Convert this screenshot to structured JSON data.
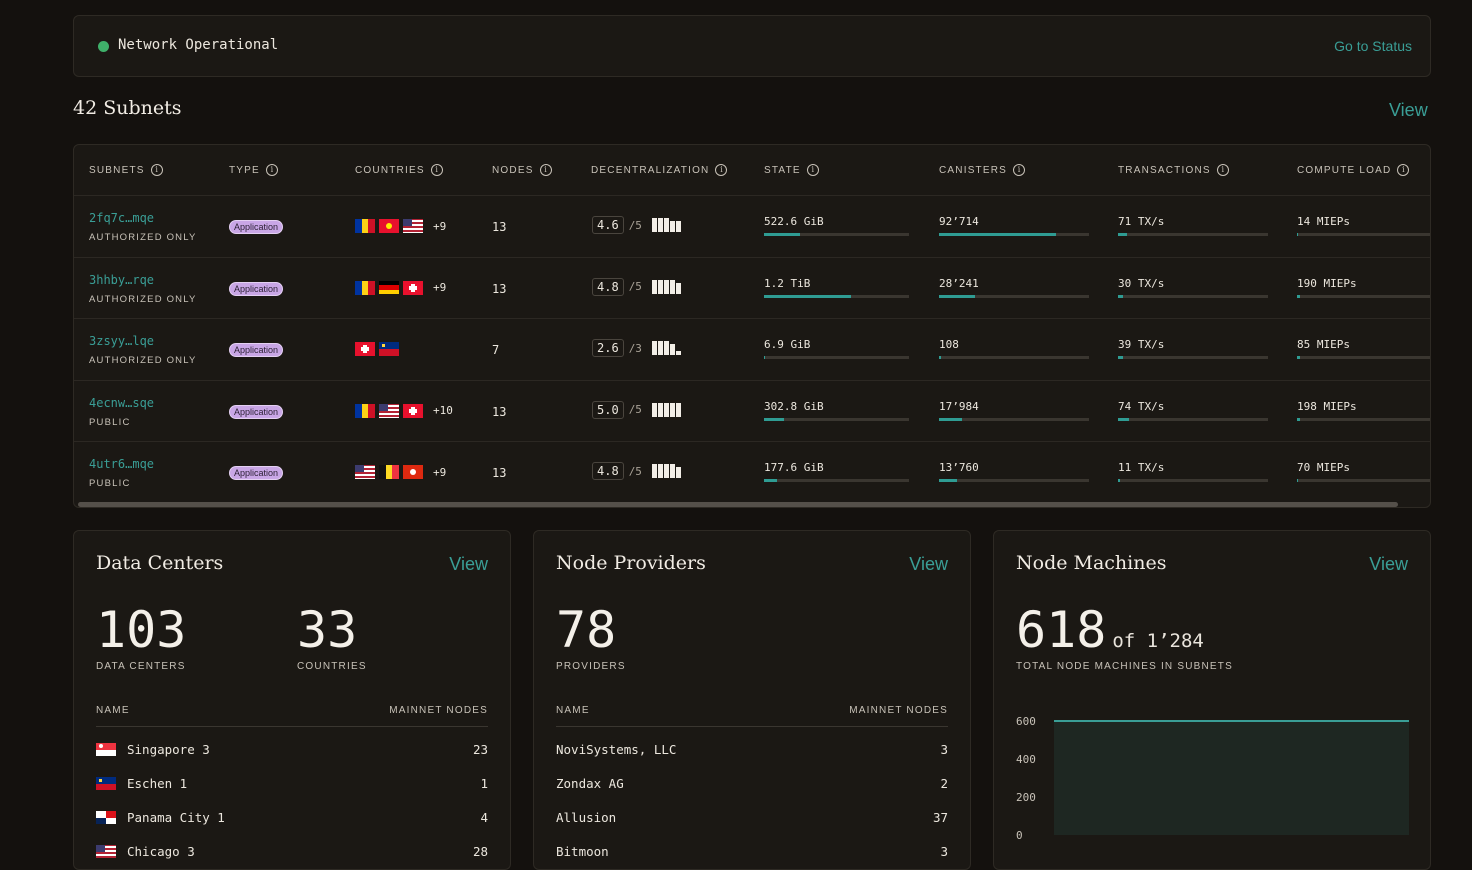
{
  "status": {
    "text": "Network Operational",
    "link": "Go to Status",
    "color": "#3fb06a"
  },
  "subnets_section": {
    "title": "42 Subnets",
    "view": "View"
  },
  "table": {
    "headers": [
      "SUBNETS",
      "TYPE",
      "COUNTRIES",
      "NODES",
      "DECENTRALIZATION",
      "STATE",
      "CANISTERS",
      "TRANSACTIONS",
      "COMPUTE LOAD"
    ],
    "rows": [
      {
        "id": "2fq7c…mqe",
        "access": "AUTHORIZED ONLY",
        "type": "Application",
        "flags": [
          "RO",
          "KG",
          "US"
        ],
        "more": "+9",
        "nodes": "13",
        "score": "4.6",
        "out_of": "/5",
        "bar_levels": [
          1,
          1,
          1,
          0.75,
          0.75
        ],
        "state": "522.6 GiB",
        "state_pct": 25,
        "canisters": "92’714",
        "canisters_pct": 78,
        "tx": "71 TX/s",
        "tx_pct": 6,
        "load": "14 MIEPs",
        "load_pct": 1
      },
      {
        "id": "3hhby…rqe",
        "access": "AUTHORIZED ONLY",
        "type": "Application",
        "flags": [
          "RO",
          "DE",
          "CH"
        ],
        "more": "+9",
        "nodes": "13",
        "score": "4.8",
        "out_of": "/5",
        "bar_levels": [
          1,
          1,
          1,
          1,
          0.75
        ],
        "state": "1.2 TiB",
        "state_pct": 60,
        "canisters": "28’241",
        "canisters_pct": 24,
        "tx": "30 TX/s",
        "tx_pct": 3,
        "load": "190 MIEPs",
        "load_pct": 2
      },
      {
        "id": "3zsyy…lqe",
        "access": "AUTHORIZED ONLY",
        "type": "Application",
        "flags": [
          "CH",
          "LI"
        ],
        "more": "",
        "nodes": "7",
        "score": "2.6",
        "out_of": "/3",
        "bar_levels": [
          1,
          1,
          1,
          0.75,
          0.3
        ],
        "state": "6.9 GiB",
        "state_pct": 1,
        "canisters": "108",
        "canisters_pct": 1,
        "tx": "39 TX/s",
        "tx_pct": 3,
        "load": "85 MIEPs",
        "load_pct": 2
      },
      {
        "id": "4ecnw…sqe",
        "access": "PUBLIC",
        "type": "Application",
        "flags": [
          "RO",
          "US",
          "CH"
        ],
        "more": "+10",
        "nodes": "13",
        "score": "5.0",
        "out_of": "/5",
        "bar_levels": [
          1,
          1,
          1,
          1,
          1
        ],
        "state": "302.8 GiB",
        "state_pct": 14,
        "canisters": "17’984",
        "canisters_pct": 15,
        "tx": "74 TX/s",
        "tx_pct": 7,
        "load": "198 MIEPs",
        "load_pct": 2
      },
      {
        "id": "4utr6…mqe",
        "access": "PUBLIC",
        "type": "Application",
        "flags": [
          "US",
          "BE",
          "HK"
        ],
        "more": "+9",
        "nodes": "13",
        "score": "4.8",
        "out_of": "/5",
        "bar_levels": [
          1,
          1,
          1,
          1,
          0.75
        ],
        "state": "177.6 GiB",
        "state_pct": 9,
        "canisters": "13’760",
        "canisters_pct": 12,
        "tx": "11 TX/s",
        "tx_pct": 1,
        "load": "70 MIEPs",
        "load_pct": 1
      }
    ]
  },
  "data_centers": {
    "title": "Data Centers",
    "view": "View",
    "count": "103",
    "count_label": "DATA CENTERS",
    "countries": "33",
    "countries_label": "COUNTRIES",
    "col_name": "NAME",
    "col_nodes": "MAINNET NODES",
    "items": [
      {
        "flag": "SG",
        "name": "Singapore 3",
        "nodes": "23"
      },
      {
        "flag": "LI",
        "name": "Eschen 1",
        "nodes": "1"
      },
      {
        "flag": "PA",
        "name": "Panama City 1",
        "nodes": "4"
      },
      {
        "flag": "US",
        "name": "Chicago 3",
        "nodes": "28"
      }
    ]
  },
  "node_providers": {
    "title": "Node Providers",
    "view": "View",
    "count": "78",
    "count_label": "PROVIDERS",
    "col_name": "NAME",
    "col_nodes": "MAINNET NODES",
    "items": [
      {
        "name": "NoviSystems, LLC",
        "nodes": "3"
      },
      {
        "name": "Zondax AG",
        "nodes": "2"
      },
      {
        "name": "Allusion",
        "nodes": "37"
      },
      {
        "name": "Bitmoon",
        "nodes": "3"
      }
    ]
  },
  "node_machines": {
    "title": "Node Machines",
    "view": "View",
    "count": "618",
    "of_text": "of 1’284",
    "count_label": "TOTAL NODE MACHINES IN SUBNETS",
    "chart_data": {
      "type": "area",
      "y_ticks": [
        "600",
        "400",
        "200",
        "0"
      ],
      "ylim": [
        0,
        600
      ],
      "values": [
        618,
        618,
        618,
        618,
        618,
        618,
        618,
        618,
        618,
        618
      ]
    }
  },
  "colors": {
    "accent": "#3a9e96",
    "bar_fill": "#2f9c93",
    "badge": "#c9a6e6"
  }
}
